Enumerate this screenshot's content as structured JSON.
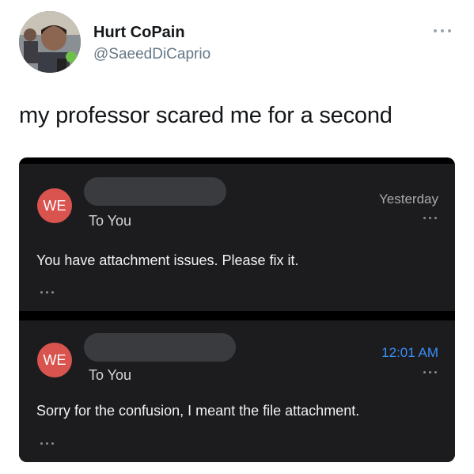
{
  "author": {
    "name": "Hurt CoPain",
    "handle": "@SaeedDiCaprio"
  },
  "tweet": {
    "text": "my professor scared me for a second"
  },
  "emails": [
    {
      "avatar_initials": "WE",
      "recipient": "To You",
      "time": "Yesterday",
      "body": "You have attachment issues. Please fix it."
    },
    {
      "avatar_initials": "WE",
      "recipient": "To You",
      "time": "12:01 AM",
      "body": "Sorry for the confusion, I meant the file attachment."
    }
  ],
  "colors": {
    "avatar_red": "#d9534f",
    "time_blue": "#3a8ef6",
    "card_bg": "#1c1c1e"
  }
}
